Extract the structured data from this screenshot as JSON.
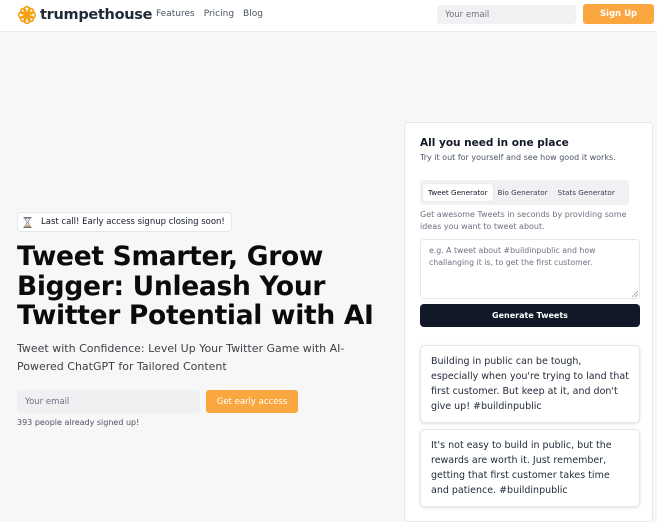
{
  "header": {
    "brand": "trumpethouse",
    "nav": [
      "Features",
      "Pricing",
      "Blog"
    ],
    "email_placeholder": "Your email",
    "signup_label": "Sign Up"
  },
  "hero": {
    "badge_text": "Last call! Early access signup closing soon!",
    "headline": "Tweet Smarter, Grow Bigger: Unleash Your Twitter Potential with AI",
    "subheadline": "Tweet with Confidence: Level Up Your Twitter Game with AI-Powered ChatGPT for Tailored Content",
    "email_placeholder": "Your email",
    "cta_label": "Get early access",
    "signed_up_text": "393 people already signed up!"
  },
  "panel": {
    "title": "All you need in one place",
    "subtitle": "Try it out for yourself and see how good it works.",
    "tabs": [
      "Tweet Generator",
      "Bio Generator",
      "Stats Generator"
    ],
    "active_tab": "Tweet Generator",
    "description": "Get awesome Tweets in seconds by providing some ideas you want to tweet about.",
    "textarea_placeholder": "e.g. A tweet about #buildinpublic and how challanging it is, to get the first customer.",
    "generate_label": "Generate Tweets",
    "tweets": [
      "Building in public can be tough, especially when you're trying to land that first customer. But keep at it, and don't give up! #buildinpublic",
      "It's not easy to build in public, but the rewards are worth it. Just remember, getting that first customer takes time and patience. #buildinpublic"
    ]
  },
  "colors": {
    "accent": "#fba740",
    "dark_button": "#111827",
    "background": "#f7f7f8"
  },
  "icons": {
    "logo": "flower-logo-icon",
    "badge": "hourglass-icon",
    "textarea": "resize-handle-icon"
  }
}
